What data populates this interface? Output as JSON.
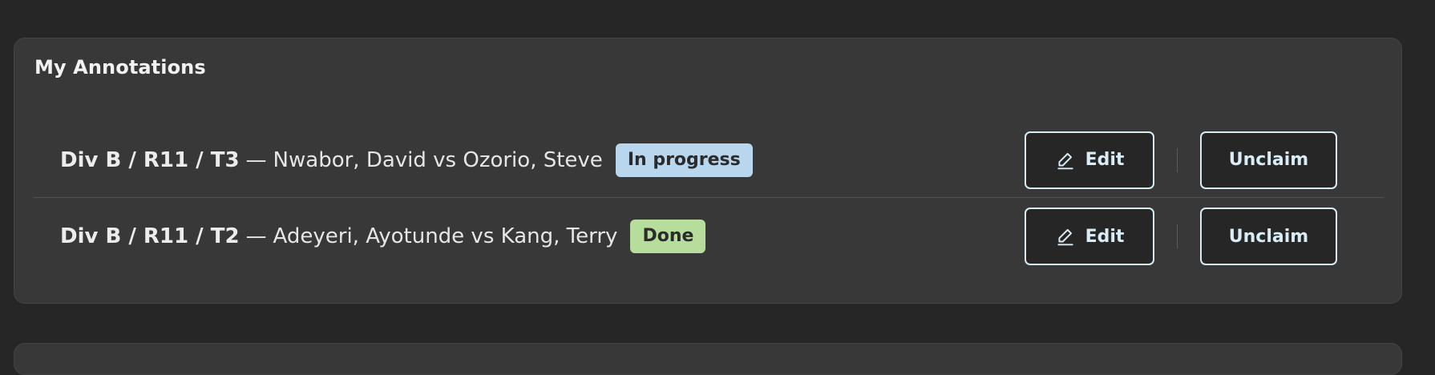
{
  "section": {
    "title": "My Annotations"
  },
  "annotations": [
    {
      "id": "Div B / R11 / T3",
      "separator": "—",
      "players": "Nwabor, David vs Ozorio, Steve",
      "status": "In progress",
      "status_color": "#b8d6ee",
      "edit_label": "Edit",
      "unclaim_label": "Unclaim"
    },
    {
      "id": "Div B / R11 / T2",
      "separator": "—",
      "players": "Adeyeri, Ayotunde vs Kang, Terry",
      "status": "Done",
      "status_color": "#b7dd9c",
      "edit_label": "Edit",
      "unclaim_label": "Unclaim"
    }
  ],
  "icons": {
    "edit": "pencil-icon"
  },
  "colors": {
    "background": "#262626",
    "card": "#383838",
    "button_border": "#d9ecf5"
  }
}
